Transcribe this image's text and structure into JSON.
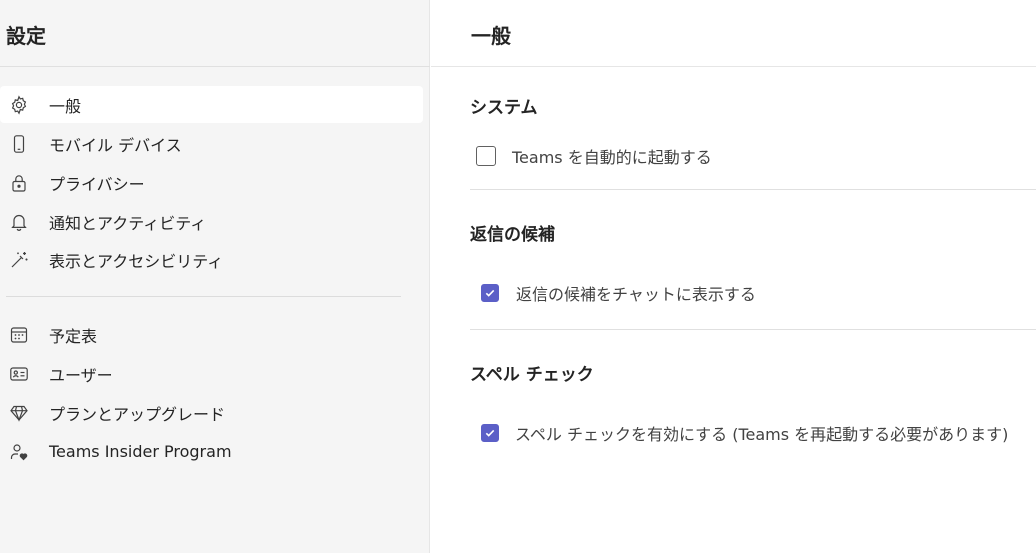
{
  "sidebar": {
    "title": "設定",
    "items": [
      {
        "label": "一般",
        "icon": "gear-icon",
        "selected": true
      },
      {
        "label": "モバイル デバイス",
        "icon": "mobile-device-icon"
      },
      {
        "label": "プライバシー",
        "icon": "lock-icon"
      },
      {
        "label": "通知とアクティビティ",
        "icon": "bell-icon"
      },
      {
        "label": "表示とアクセシビリティ",
        "icon": "magic-wand-icon"
      },
      {
        "label": "予定表",
        "icon": "calendar-icon"
      },
      {
        "label": "ユーザー",
        "icon": "contact-card-icon"
      },
      {
        "label": "プランとアップグレード",
        "icon": "diamond-icon"
      },
      {
        "label": "Teams Insider Program",
        "icon": "person-heart-icon"
      }
    ]
  },
  "main": {
    "title": "一般",
    "sections": [
      {
        "title": "システム",
        "option": {
          "label": "Teams を自動的に起動する",
          "checked": false
        }
      },
      {
        "title": "返信の候補",
        "option": {
          "label": "返信の候補をチャットに表示する",
          "checked": true
        }
      },
      {
        "title": "スペル チェック",
        "option": {
          "label": "スペル チェックを有効にする (Teams を再起動する必要があります)",
          "checked": true
        }
      }
    ]
  },
  "colors": {
    "accent": "#5b5fc7",
    "sidebar_bg": "#f5f5f5",
    "selected_item_bg": "#ffffff"
  }
}
